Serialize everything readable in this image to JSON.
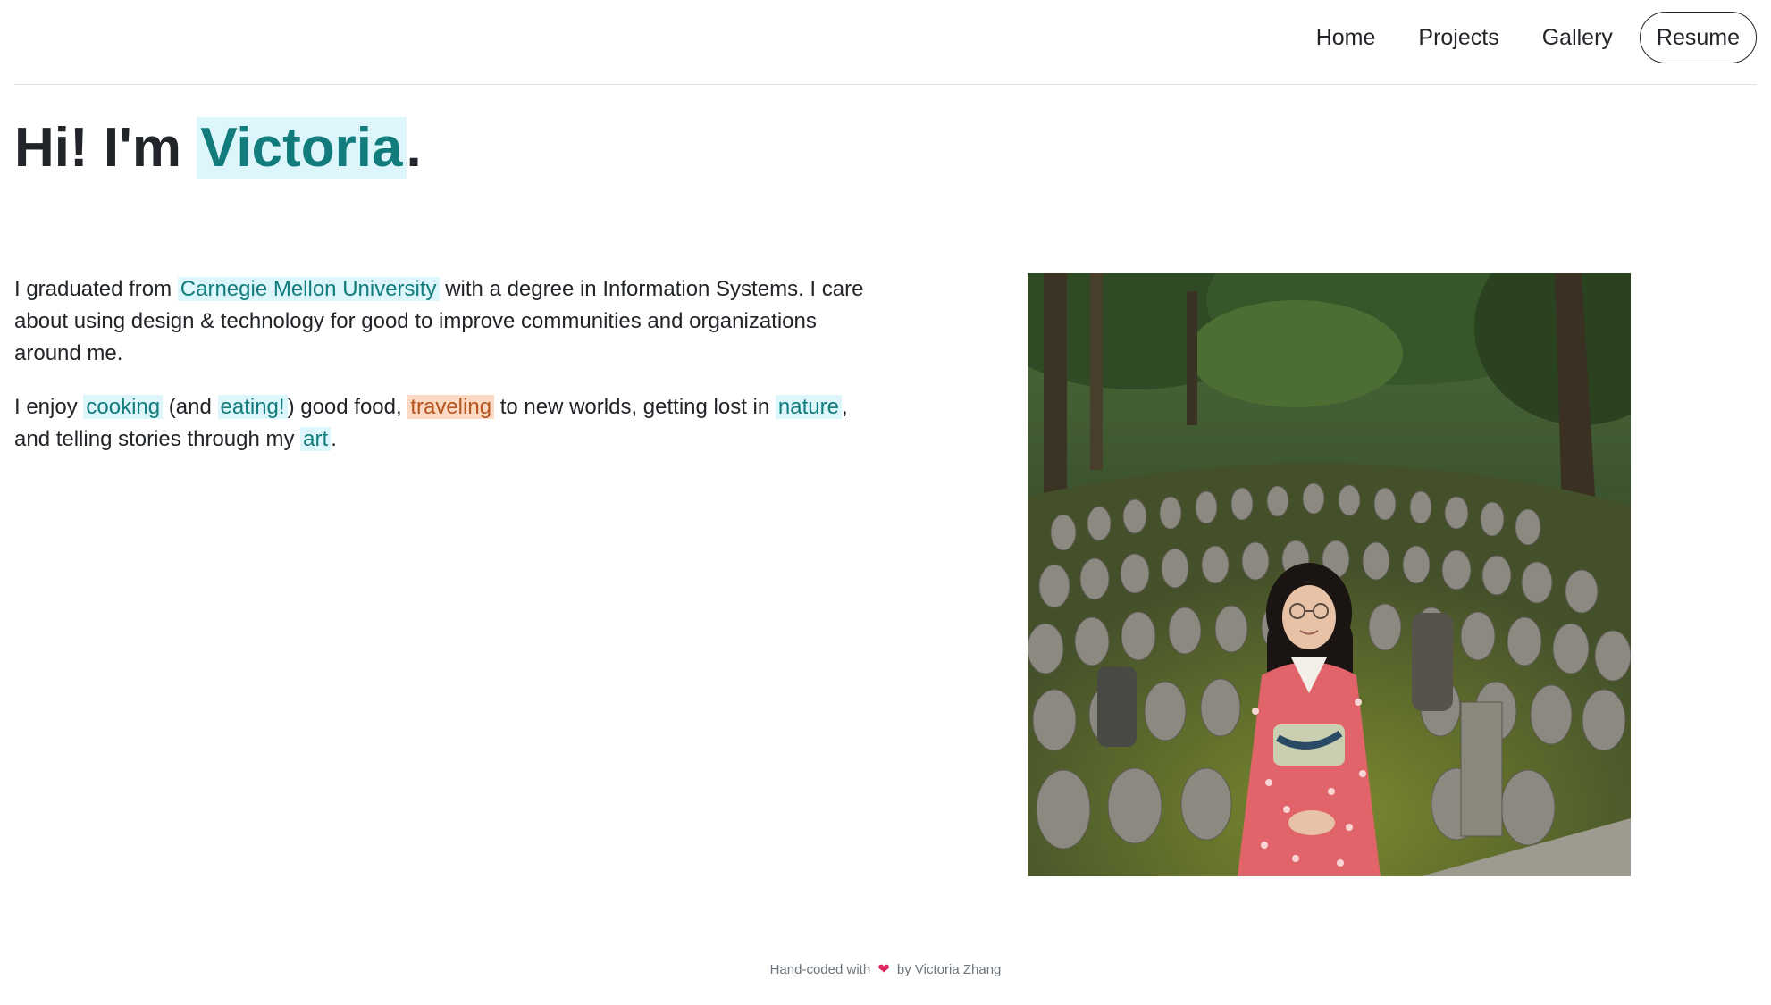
{
  "nav": {
    "home": "Home",
    "projects": "Projects",
    "gallery": "Gallery",
    "resume": "Resume"
  },
  "hero": {
    "prefix": "Hi! I'm ",
    "name": "Victoria",
    "suffix": "."
  },
  "intro": {
    "p1": {
      "t1": "I graduated from ",
      "university": "Carnegie Mellon University",
      "t2": " with a degree in Information Systems. I care about using design & technology for good to improve communities and organizations around me."
    },
    "p2": {
      "t1": "I enjoy ",
      "cooking": "cooking",
      "t2": " (and ",
      "eating": "eating!",
      "t3": ") good food, ",
      "traveling": "traveling",
      "t4": " to new worlds, getting lost in ",
      "nature": "nature",
      "t5": ", and telling stories through my ",
      "art": "art",
      "t6": "."
    }
  },
  "photo": {
    "icon": "photo-portrait"
  },
  "footer": {
    "t1": "Hand-coded with",
    "heart": "❤",
    "t2": "by Victoria Zhang"
  },
  "colors": {
    "highlight_blue_bg": "#dcf6fb",
    "highlight_blue_text": "#127c7c",
    "highlight_orange_bg": "#fcd9c2",
    "highlight_orange_text": "#b4541e",
    "heart": "#e0245e"
  }
}
